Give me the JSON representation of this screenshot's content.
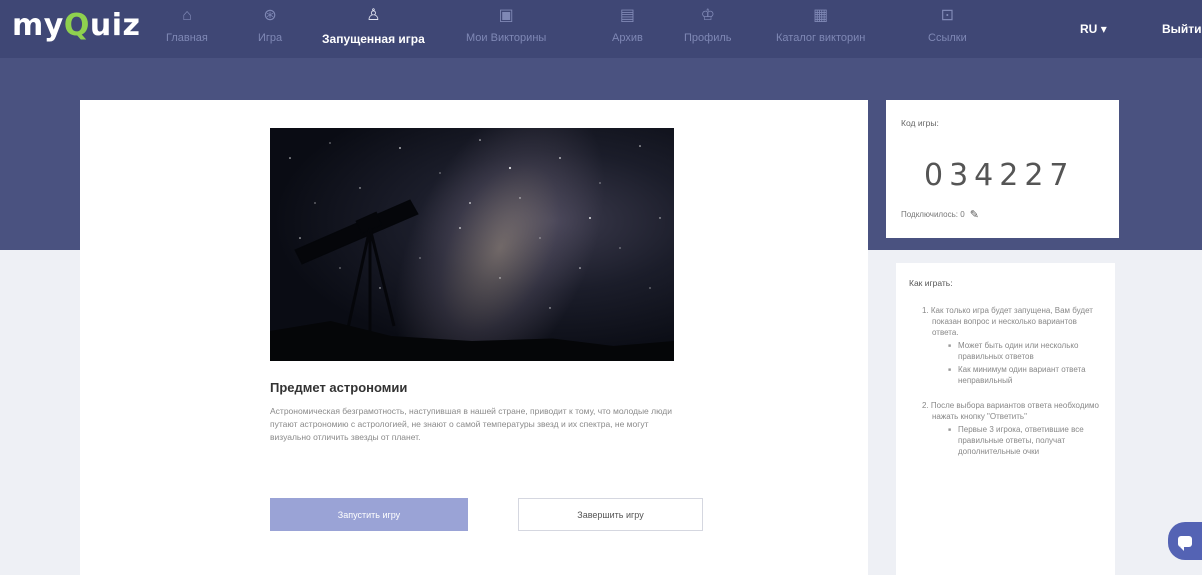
{
  "brand": {
    "logo_prefix": "my",
    "logo_q": "Q",
    "logo_suffix": "uiz"
  },
  "nav": {
    "items": [
      {
        "label": "Главная",
        "icon": "home-icon"
      },
      {
        "label": "Игра",
        "icon": "gamepad-icon"
      },
      {
        "label": "Запущенная игра",
        "icon": "running-game-icon",
        "active": true
      },
      {
        "label": "Мои Викторины",
        "icon": "quiz-list-icon"
      },
      {
        "label": "Архив",
        "icon": "archive-icon"
      },
      {
        "label": "Профиль",
        "icon": "profile-icon"
      },
      {
        "label": "Каталог викторин",
        "icon": "catalog-icon"
      },
      {
        "label": "Ссылки",
        "icon": "links-icon"
      }
    ],
    "language": "RU",
    "logout": "Выйти"
  },
  "quiz": {
    "title": "Предмет астрономии",
    "description": "Астрономическая безграмотность, наступившая в нашей стране, приводит к тому, что молодые люди путают астрономию с астрологией, не знают о самой температуры звезд и их спектра, не могут визуально отличить звезды от планет.",
    "start_button": "Запустить игру",
    "finish_button": "Завершить игру"
  },
  "game_code": {
    "label": "Код игры:",
    "value": "034227",
    "subscribers_label": "Подключилось: 0"
  },
  "how_to_play": {
    "title": "Как играть:",
    "steps": [
      {
        "text": "1. Как только игра будет запущена, Вам будет показан вопрос и несколько вариантов ответа.",
        "sub": [
          "Может быть один или несколько правильных ответов",
          "Как минимум один вариант ответа неправильный"
        ]
      },
      {
        "text": "2. После выбора вариантов ответа необходимо нажать кнопку \"Ответить\"",
        "sub": [
          "Первые 3 игрока, ответившие все правильные ответы, получат дополнительные очки"
        ]
      }
    ]
  },
  "colors": {
    "header_bg": "#4a5280",
    "nav_bg": "#3f4775",
    "accent_green": "#8fd14f",
    "start_button_bg": "#9aa3d6",
    "chat_button_bg": "#5463b4"
  }
}
